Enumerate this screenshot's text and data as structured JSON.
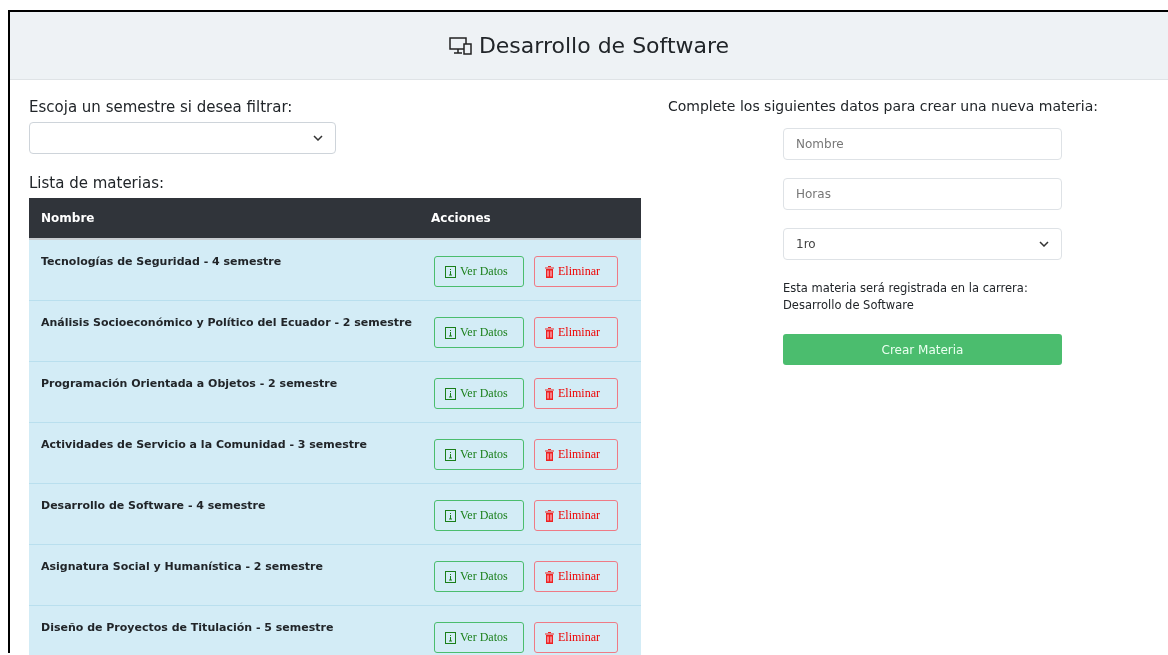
{
  "header": {
    "title": "Desarrollo de Software"
  },
  "filter": {
    "label": "Escoja un semestre si desea filtrar:"
  },
  "list": {
    "title": "Lista de materias:",
    "columns": [
      "Nombre",
      "Acciones"
    ],
    "rows": [
      {
        "name": "Tecnologías de Seguridad - 4 semestre",
        "view": "Ver Datos",
        "delete": "Eliminar"
      },
      {
        "name": "Análisis Socioeconómico y Político del Ecuador - 2 semestre",
        "view": "Ver Datos",
        "delete": "Eliminar"
      },
      {
        "name": "Programación Orientada a Objetos - 2 semestre",
        "view": "Ver Datos",
        "delete": "Eliminar"
      },
      {
        "name": "Actividades de Servicio a la Comunidad - 3 semestre",
        "view": "Ver Datos",
        "delete": "Eliminar"
      },
      {
        "name": "Desarrollo de Software - 4 semestre",
        "view": "Ver Datos",
        "delete": "Eliminar"
      },
      {
        "name": "Asignatura Social y Humanística - 2 semestre",
        "view": "Ver Datos",
        "delete": "Eliminar"
      },
      {
        "name": "Diseño de Proyectos de Titulación - 5 semestre",
        "view": "Ver Datos",
        "delete": "Eliminar"
      }
    ]
  },
  "form": {
    "title": "Complete los siguientes datos para crear una nueva materia:",
    "name_placeholder": "Nombre",
    "hours_placeholder": "Horas",
    "semester": "1ro",
    "note_line1": "Esta materia será registrada en la carrera:",
    "note_line2": "Desarrollo de Software",
    "submit": "Crear Materia"
  }
}
